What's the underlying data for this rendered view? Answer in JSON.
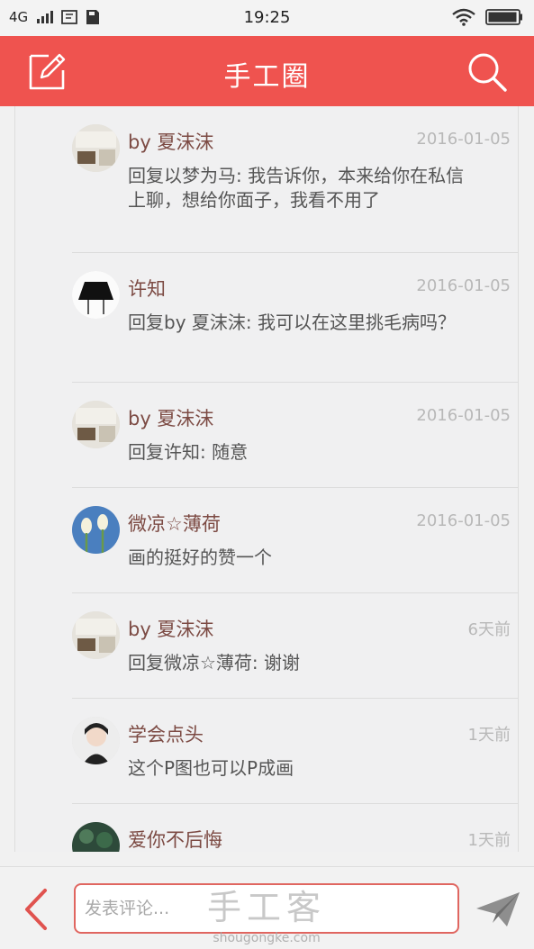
{
  "status_bar": {
    "network": "4G",
    "time": "19:25"
  },
  "app_bar": {
    "title": "手工圈"
  },
  "comments": [
    {
      "user": "by 夏沫沫",
      "time": "2016-01-05",
      "text": "回复以梦为马: 我告诉你，本来给你在私信上聊，想给你面子，我看不用了",
      "avatar": "room-photo"
    },
    {
      "user": "许知",
      "time": "2016-01-05",
      "text": "回复by 夏沫沫: 我可以在这里挑毛病吗？",
      "avatar": "skirt-drawing"
    },
    {
      "user": "by 夏沫沫",
      "time": "2016-01-05",
      "text": "回复许知: 随意",
      "avatar": "room-photo"
    },
    {
      "user": "微凉☆薄荷",
      "time": "2016-01-05",
      "text": "画的挺好的赞一个",
      "avatar": "tulips-photo"
    },
    {
      "user": "by 夏沫沫",
      "time": "6天前",
      "text": "回复微凉☆薄荷: 谢谢",
      "avatar": "room-photo"
    },
    {
      "user": "学会点头",
      "time": "1天前",
      "text": "这个P图也可以P成画",
      "avatar": "girl-photo"
    },
    {
      "user": "爱你不后悔",
      "time": "1天前",
      "text": "",
      "avatar": "plant-photo"
    }
  ],
  "comment_input": {
    "placeholder": "发表评论..."
  },
  "watermark": {
    "name": "手工客",
    "url": "shougongke.com"
  },
  "colors": {
    "accent": "#ef534f",
    "username": "#7c4a43",
    "time": "#b8b8b8"
  }
}
